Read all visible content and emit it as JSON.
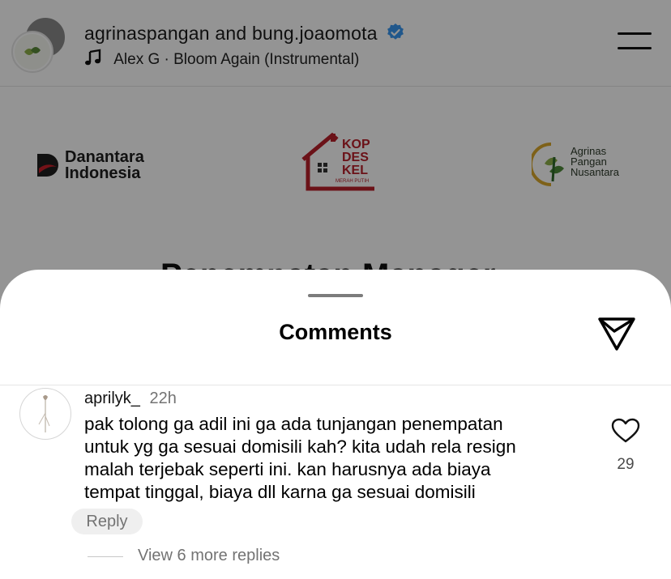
{
  "post": {
    "users": "agrinaspangan and bung.joaomota",
    "music": "Alex G · Bloom Again (Instrumental)",
    "logos": {
      "danantara_line1": "Danantara",
      "danantara_line2": "Indonesia",
      "kopdes_line1": "KOP",
      "kopdes_line2": "DES",
      "kopdes_line3": "KEL",
      "kopdes_sub": "MERAH PUTIH",
      "agrinas_line1": "Agrinas",
      "agrinas_line2": "Pangan",
      "agrinas_line3": "Nusantara"
    },
    "headline": "Penempatan Manager"
  },
  "sheet": {
    "title": "Comments"
  },
  "comment": {
    "username": "aprilyk_",
    "time": "22h",
    "lines": [
      "pak tolong ga adil ini ga ada tunjangan penempatan",
      "untuk yg ga sesuai domisili kah? kita udah rela resign",
      "malah terjebak seperti ini. kan harusnya ada biaya",
      "tempat tinggal, biaya dll karna ga sesuai domisili"
    ],
    "likes": "29",
    "reply_label": "Reply",
    "view_replies": "View 6 more replies"
  },
  "colors": {
    "verified": "#3897f0",
    "kopdes_red": "#b81f2a",
    "secondary_text": "#737373"
  },
  "icons": [
    "verified-badge-icon",
    "music-note-icon",
    "menu-icon",
    "share-send-icon",
    "heart-icon"
  ]
}
